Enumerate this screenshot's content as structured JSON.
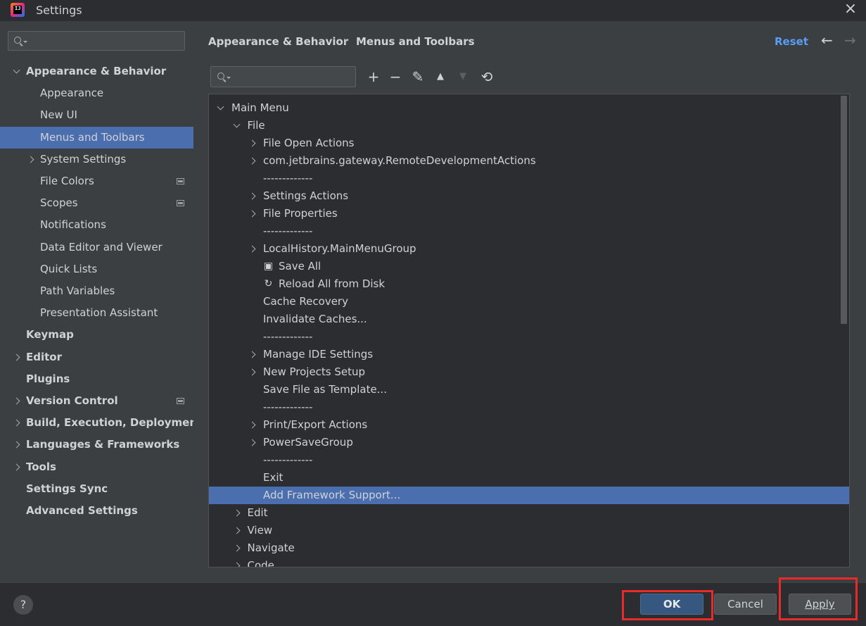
{
  "window": {
    "title": "Settings"
  },
  "sidebar": {
    "search": {
      "value": "",
      "placeholder": ""
    },
    "items": [
      {
        "label": "Appearance & Behavior",
        "level": 0,
        "bold": true,
        "expander": "down",
        "name": "sidebar-item-appearance-behavior"
      },
      {
        "label": "Appearance",
        "level": 1,
        "name": "sidebar-item-appearance"
      },
      {
        "label": "New UI",
        "level": 1,
        "name": "sidebar-item-new-ui"
      },
      {
        "label": "Menus and Toolbars",
        "level": 1,
        "selected": true,
        "name": "sidebar-item-menus-toolbars"
      },
      {
        "label": "System Settings",
        "level": 1,
        "expander": "right",
        "name": "sidebar-item-system-settings"
      },
      {
        "label": "File Colors",
        "level": 1,
        "project_icon": true,
        "name": "sidebar-item-file-colors"
      },
      {
        "label": "Scopes",
        "level": 1,
        "project_icon": true,
        "name": "sidebar-item-scopes"
      },
      {
        "label": "Notifications",
        "level": 1,
        "name": "sidebar-item-notifications"
      },
      {
        "label": "Data Editor and Viewer",
        "level": 1,
        "name": "sidebar-item-data-editor"
      },
      {
        "label": "Quick Lists",
        "level": 1,
        "name": "sidebar-item-quick-lists"
      },
      {
        "label": "Path Variables",
        "level": 1,
        "name": "sidebar-item-path-variables"
      },
      {
        "label": "Presentation Assistant",
        "level": 1,
        "name": "sidebar-item-presentation-assistant"
      },
      {
        "label": "Keymap",
        "level": 0,
        "bold": true,
        "name": "sidebar-item-keymap"
      },
      {
        "label": "Editor",
        "level": 0,
        "bold": true,
        "expander": "right",
        "name": "sidebar-item-editor"
      },
      {
        "label": "Plugins",
        "level": 0,
        "bold": true,
        "name": "sidebar-item-plugins"
      },
      {
        "label": "Version Control",
        "level": 0,
        "bold": true,
        "expander": "right",
        "project_icon": true,
        "name": "sidebar-item-version-control"
      },
      {
        "label": "Build, Execution, Deployment",
        "level": 0,
        "bold": true,
        "expander": "right",
        "name": "sidebar-item-build"
      },
      {
        "label": "Languages & Frameworks",
        "level": 0,
        "bold": true,
        "expander": "right",
        "name": "sidebar-item-languages"
      },
      {
        "label": "Tools",
        "level": 0,
        "bold": true,
        "expander": "right",
        "name": "sidebar-item-tools"
      },
      {
        "label": "Settings Sync",
        "level": 0,
        "bold": true,
        "name": "sidebar-item-settings-sync"
      },
      {
        "label": "Advanced Settings",
        "level": 0,
        "bold": true,
        "name": "sidebar-item-advanced-settings"
      }
    ]
  },
  "header": {
    "breadcrumb_parent": "Appearance & Behavior",
    "breadcrumb_separator": "›",
    "breadcrumb_current": "Menus and Toolbars",
    "reset_label": "Reset",
    "back_icon": "←",
    "forward_icon": "→"
  },
  "toolbar": {
    "search": {
      "value": "",
      "placeholder": ""
    },
    "buttons": [
      {
        "name": "add-icon",
        "glyph": "+",
        "disabled": false
      },
      {
        "name": "remove-icon",
        "glyph": "−",
        "disabled": false
      },
      {
        "name": "edit-icon",
        "glyph": "✎",
        "disabled": false
      },
      {
        "name": "move-up-icon",
        "glyph": "▲",
        "disabled": false
      },
      {
        "name": "move-down-icon",
        "glyph": "▼",
        "disabled": true
      },
      {
        "name": "restore-icon",
        "glyph": "⟲",
        "disabled": false
      }
    ]
  },
  "menu_tree": [
    {
      "label": "Main Menu",
      "depth": 0,
      "expander": "down"
    },
    {
      "label": "File",
      "depth": 1,
      "expander": "down"
    },
    {
      "label": "File Open Actions",
      "depth": 2,
      "expander": "right"
    },
    {
      "label": "com.jetbrains.gateway.RemoteDevelopmentActions",
      "depth": 2,
      "expander": "right"
    },
    {
      "label": "-------------",
      "depth": 2,
      "separator": true
    },
    {
      "label": "Settings Actions",
      "depth": 2,
      "expander": "right"
    },
    {
      "label": "File Properties",
      "depth": 2,
      "expander": "right"
    },
    {
      "label": "-------------",
      "depth": 2,
      "separator": true
    },
    {
      "label": "LocalHistory.MainMenuGroup",
      "depth": 2,
      "expander": "right"
    },
    {
      "label": "Save All",
      "depth": 2,
      "icon": "save-icon"
    },
    {
      "label": "Reload All from Disk",
      "depth": 2,
      "icon": "reload-icon"
    },
    {
      "label": "Cache Recovery",
      "depth": 2
    },
    {
      "label": "Invalidate Caches...",
      "depth": 2
    },
    {
      "label": "-------------",
      "depth": 2,
      "separator": true
    },
    {
      "label": "Manage IDE Settings",
      "depth": 2,
      "expander": "right"
    },
    {
      "label": "New Projects Setup",
      "depth": 2,
      "expander": "right"
    },
    {
      "label": "Save File as Template...",
      "depth": 2
    },
    {
      "label": "-------------",
      "depth": 2,
      "separator": true
    },
    {
      "label": "Print/Export Actions",
      "depth": 2,
      "expander": "right"
    },
    {
      "label": "PowerSaveGroup",
      "depth": 2,
      "expander": "right"
    },
    {
      "label": "-------------",
      "depth": 2,
      "separator": true
    },
    {
      "label": "Exit",
      "depth": 2
    },
    {
      "label": "Add Framework Support...",
      "depth": 2,
      "selected": true
    },
    {
      "label": "Edit",
      "depth": 1,
      "expander": "right"
    },
    {
      "label": "View",
      "depth": 1,
      "expander": "right"
    },
    {
      "label": "Navigate",
      "depth": 1,
      "expander": "right"
    },
    {
      "label": "Code",
      "depth": 1,
      "expander": "right"
    }
  ],
  "footer": {
    "help_label": "?",
    "ok_label": "OK",
    "cancel_label": "Cancel",
    "apply_label": "Apply"
  },
  "colors": {
    "selection": "#4b6eaf",
    "link": "#589df6",
    "highlight_box": "#e82a2a"
  }
}
